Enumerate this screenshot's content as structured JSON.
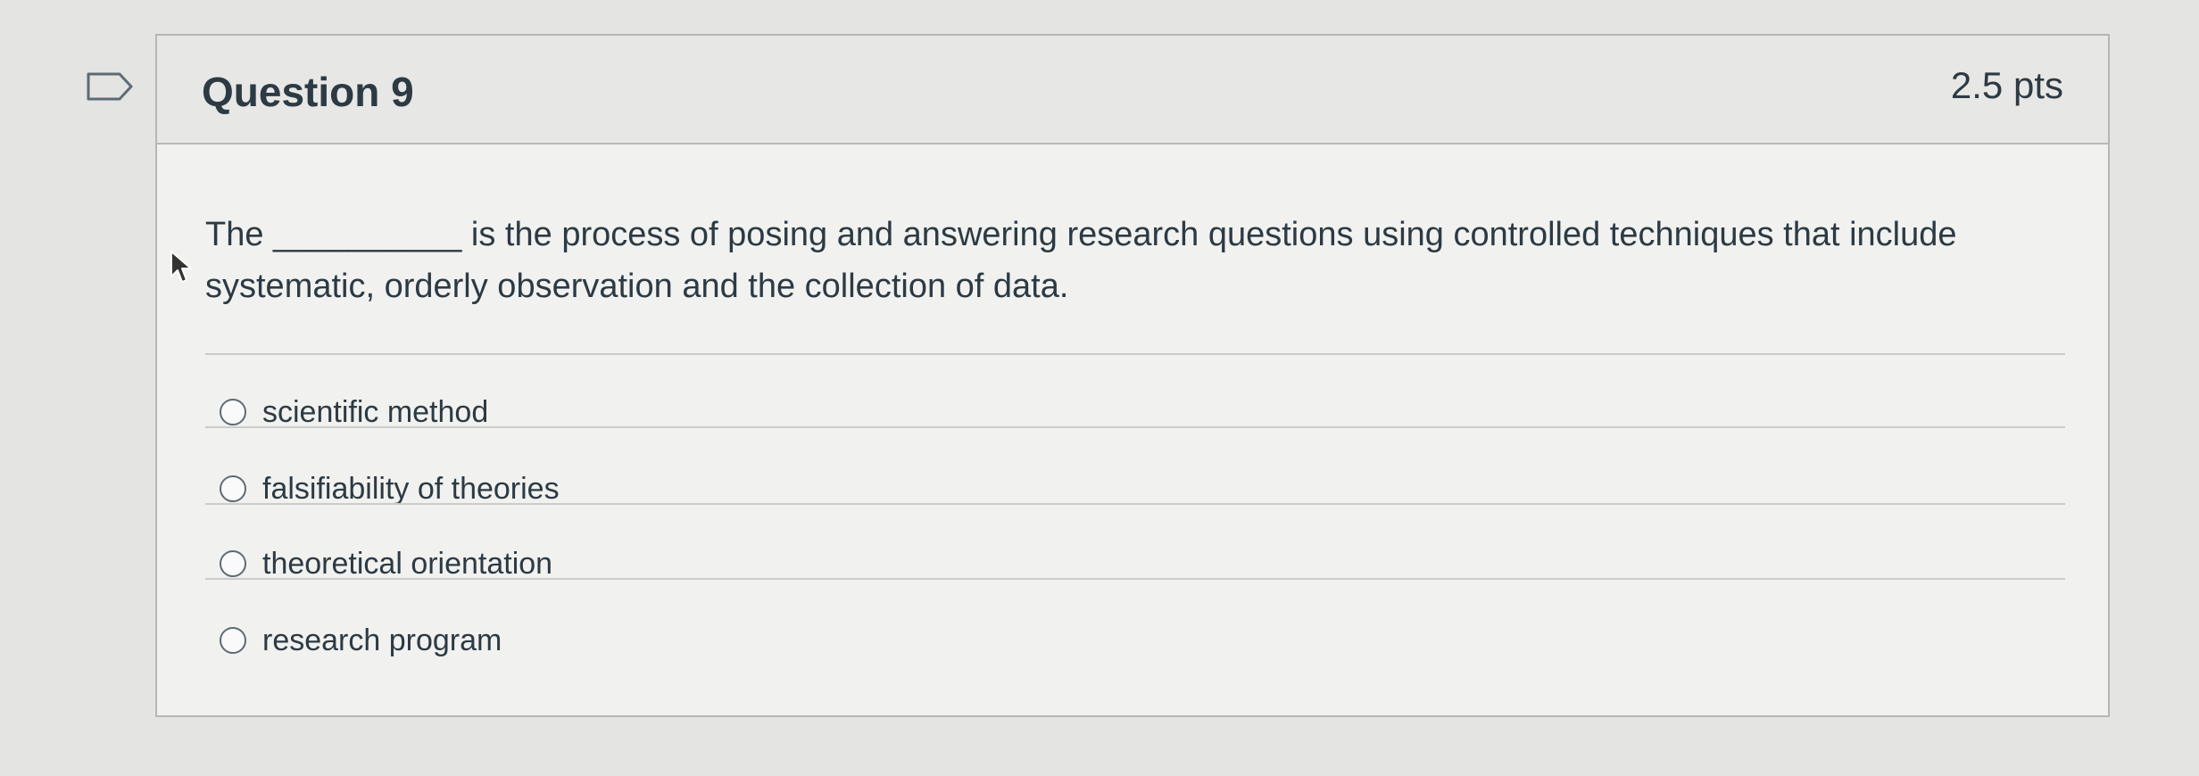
{
  "question": {
    "title": "Question 9",
    "points": "2.5 pts",
    "text_line1": "The __________ is the process of posing and answering research questions using controlled techniques that include",
    "text_line2": "systematic, orderly observation and the collection of data."
  },
  "answers": [
    {
      "label": "scientific method",
      "selected": false
    },
    {
      "label": "falsifiability of theories",
      "selected": false
    },
    {
      "label": "theoretical orientation",
      "selected": false
    },
    {
      "label": "research program",
      "selected": false
    }
  ],
  "icons": {
    "flag": "flag-question-icon",
    "cursor": "mouse-pointer-icon"
  }
}
